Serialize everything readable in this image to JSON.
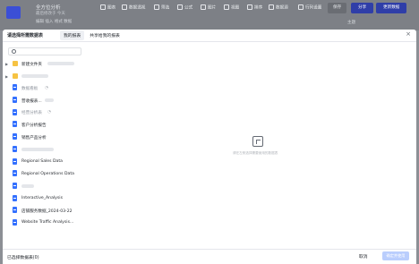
{
  "app": {
    "title": "全方位分析",
    "subtitle": "最后修改于 今天",
    "menu": "编辑  插入  格式  数据",
    "tools": [
      "图表",
      "数据透视",
      "筛选",
      "公式",
      "图片",
      "视图",
      "排序",
      "数据源",
      "行列设置",
      "页面设置"
    ],
    "pill": "保存",
    "share_button": "分享",
    "primary_button": "更新数据",
    "grid_label": "主题"
  },
  "modal": {
    "title": "请选择所需数据表",
    "tabs": [
      "我的报表",
      "共享给我的报表"
    ],
    "search_placeholder": "",
    "items": [
      {
        "type": "folder",
        "label": "新建文件夹",
        "expandable": true
      },
      {
        "type": "folder",
        "label": "",
        "expandable": true
      },
      {
        "type": "doc",
        "label": "数据看板",
        "muted": true,
        "locked": true
      },
      {
        "type": "doc",
        "label": "营收报表...",
        "muted": false
      },
      {
        "type": "doc",
        "label": "经营分析表",
        "muted": true,
        "locked": true
      },
      {
        "type": "doc",
        "label": "客户分析报告",
        "muted": false
      },
      {
        "type": "doc",
        "label": "销售产品分析",
        "muted": false
      },
      {
        "type": "doc",
        "label": "",
        "muted": false
      },
      {
        "type": "doc",
        "label": "Regional Sales Data",
        "muted": false
      },
      {
        "type": "doc",
        "label": "Regional Operations Data",
        "muted": false
      },
      {
        "type": "doc",
        "label": "",
        "muted": false
      },
      {
        "type": "doc",
        "label": "Interactive_Analysis",
        "muted": false
      },
      {
        "type": "doc",
        "label": "店铺服务数据_2024-03-22",
        "muted": false
      },
      {
        "type": "doc",
        "label": "Website Traffic Analysis...",
        "muted": false
      }
    ],
    "empty_text": "请在左侧选择需要使用的数据表",
    "selected_count": "已选择数据表(0)",
    "cancel": "取消",
    "confirm": "确定并使用"
  }
}
